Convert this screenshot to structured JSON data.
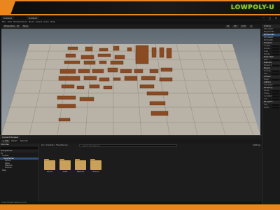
{
  "banner": {
    "brand": "LOWPOLY-U"
  },
  "window": {
    "tabs": [
      "Untitled",
      "Untitled"
    ],
    "controls": "— ▢ ✕"
  },
  "menu": [
    "File",
    "Edit",
    "Window",
    "Tools",
    "Build",
    "Select",
    "Actor",
    "Help"
  ],
  "viewport_toolbar": {
    "buttons": [
      "Perspective",
      "Lit",
      "Show"
    ],
    "right_values": [
      "10",
      "10°",
      "0.25",
      "4"
    ]
  },
  "details": {
    "outliner_title": "Outliner",
    "rows": [
      "Item Label",
      "SM_Fence01",
      "SM_Fence02",
      "SM_Gate01",
      "SM_Post01"
    ],
    "selected_row": 2,
    "sections": [
      "Transform",
      "Static Mesh",
      "Materials",
      "Physics",
      "Collision",
      "Lighting",
      "Rendering",
      "Navigation"
    ],
    "fields": [
      "Location",
      "Rotation",
      "Scale",
      "Mobility",
      "Mesh",
      "Element 0",
      "Simulate",
      "Mass",
      "Preset",
      "Cast Shadow",
      "Visible",
      "Hidden",
      "Can Affect",
      "LOD",
      "Tags",
      "Layers"
    ]
  },
  "content_browser": {
    "tab": "Content Browser",
    "toolbar": {
      "add": "+ Add",
      "import": "Import",
      "save_all": "Save All"
    },
    "sidebar_head": "Favorites",
    "sidebar_head2": "ToonyFences",
    "tree": [
      "All",
      "Content",
      "ToonyFences",
      "Fences",
      "Gates",
      "Materials",
      "Textures",
      "Maps"
    ],
    "selected_tree": 2,
    "path": "All > Content > ToonyFences",
    "search_placeholder": "Search ToonyFences",
    "settings": "Settings",
    "folders": [
      "Fences",
      "Gates",
      "Materials",
      "Textures"
    ],
    "status": "4 items"
  },
  "statusbar": "Content Drawer   Output Log   Cmd"
}
